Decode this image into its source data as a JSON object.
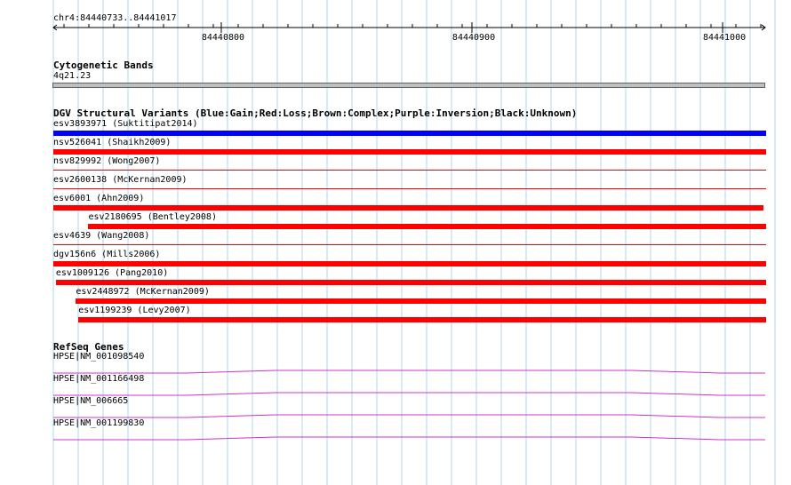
{
  "region": {
    "label": "chr4:84440733..84441017",
    "start": 84440733,
    "end": 84441017
  },
  "ruler": {
    "ticks": [
      "84440800",
      "84440900",
      "84441000"
    ]
  },
  "colors": {
    "gain": "#0000ff",
    "loss": "#ff0000",
    "complex": "#a52a2a",
    "inversion": "#800080",
    "unknown": "#000000",
    "gene": "#cc33cc",
    "grid": "#a8d8f0",
    "band": "#c0c0c0"
  },
  "cytoband": {
    "title": "Cytogenetic Bands",
    "band": "4q21.23"
  },
  "dgv": {
    "title": "DGV Structural Variants (Blue:Gain;Red:Loss;Brown:Complex;Purple:Inversion;Black:Unknown)",
    "variants": [
      {
        "label": "esv3893971 (Suktitipat2014)",
        "type": "gain",
        "start": 84440733,
        "end": 84441017,
        "style": "bar"
      },
      {
        "label": "nsv526041 (Shaikh2009)",
        "type": "loss",
        "start": 84440733,
        "end": 84441017,
        "style": "bar"
      },
      {
        "label": "nsv829992 (Wong2007)",
        "type": "loss",
        "start": 84440733,
        "end": 84441017,
        "style": "line"
      },
      {
        "label": "esv2600138 (McKernan2009)",
        "type": "loss",
        "start": 84440733,
        "end": 84441017,
        "style": "line"
      },
      {
        "label": "esv6001 (Ahn2009)",
        "type": "loss",
        "start": 84440733,
        "end": 84441016,
        "style": "bar"
      },
      {
        "label": "esv2180695 (Bentley2008)",
        "type": "loss",
        "start": 84440747,
        "end": 84441017,
        "style": "bar"
      },
      {
        "label": "esv4639 (Wang2008)",
        "type": "loss",
        "start": 84440733,
        "end": 84441017,
        "style": "line"
      },
      {
        "label": "dgv156n6 (Mills2006)",
        "type": "loss",
        "start": 84440733,
        "end": 84441017,
        "style": "bar"
      },
      {
        "label": "esv1009126 (Pang2010)",
        "type": "loss",
        "start": 84440734,
        "end": 84441017,
        "style": "bar"
      },
      {
        "label": "esv2448972 (McKernan2009)",
        "type": "loss",
        "start": 84440742,
        "end": 84441017,
        "style": "bar"
      },
      {
        "label": "esv1199239 (Levy2007)",
        "type": "loss",
        "start": 84440743,
        "end": 84441017,
        "style": "bar"
      }
    ]
  },
  "refseq": {
    "title": "RefSeq Genes",
    "genes": [
      {
        "label": "HPSE|NM_001098540"
      },
      {
        "label": "HPSE|NM_001166498"
      },
      {
        "label": "HPSE|NM_006665"
      },
      {
        "label": "HPSE|NM_001199830"
      }
    ]
  }
}
